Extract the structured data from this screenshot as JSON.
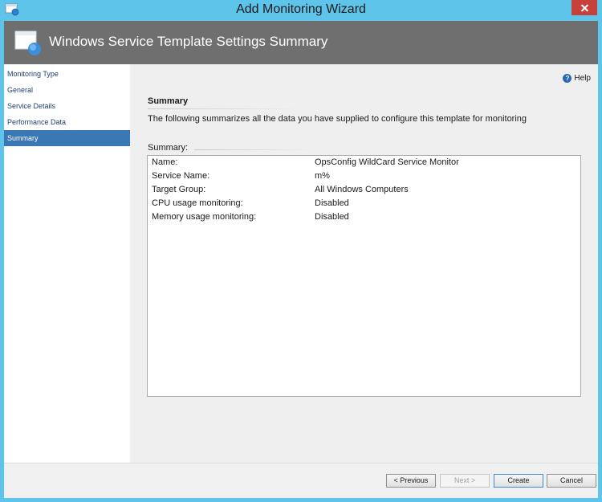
{
  "window": {
    "title": "Add Monitoring Wizard",
    "header_title": "Windows Service Template Settings Summary"
  },
  "nav": {
    "items": [
      {
        "label": "Monitoring Type",
        "active": false
      },
      {
        "label": "General",
        "active": false
      },
      {
        "label": "Service Details",
        "active": false
      },
      {
        "label": "Performance Data",
        "active": false
      },
      {
        "label": "Summary",
        "active": true
      }
    ]
  },
  "help": {
    "label": "Help"
  },
  "content": {
    "section_title": "Summary",
    "description": "The following summarizes all the data you have supplied to configure this template for monitoring",
    "summary_label": "Summary:",
    "rows": [
      {
        "key": "Name:",
        "value": "OpsConfig WildCard Service Monitor"
      },
      {
        "key": "Service Name:",
        "value": "m%"
      },
      {
        "key": "Target Group:",
        "value": "All Windows Computers"
      },
      {
        "key": "CPU usage monitoring:",
        "value": "Disabled"
      },
      {
        "key": "Memory usage monitoring:",
        "value": "Disabled"
      }
    ]
  },
  "buttons": {
    "previous": "< Previous",
    "next": "Next >",
    "create": "Create",
    "cancel": "Cancel"
  },
  "colors": {
    "titlebar": "#5ec4e9",
    "header_band": "#6f6f6f",
    "nav_active": "#3a78b5",
    "close_button": "#c7403a"
  },
  "icons": {
    "app": "wizard-app-icon",
    "header": "wizard-header-icon",
    "help": "help-icon",
    "close": "close-icon"
  }
}
